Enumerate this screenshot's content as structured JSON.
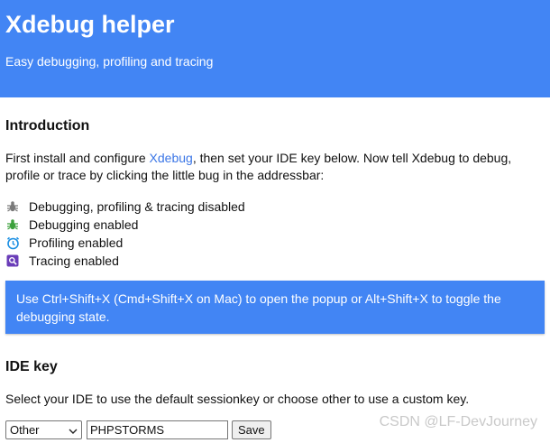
{
  "header": {
    "title": "Xdebug helper",
    "subtitle": "Easy debugging, profiling and tracing",
    "bg_color": "#4285f4"
  },
  "intro": {
    "title": "Introduction",
    "text_before_link": "First install and configure ",
    "link_text": "Xdebug",
    "text_after_link": ", then set your IDE key below. Now tell Xdebug to debug, profile or trace by clicking the little bug in the addressbar:"
  },
  "legend": [
    {
      "icon": "bug-icon-disabled",
      "color": "#7a7a7a",
      "label": "Debugging, profiling & tracing disabled"
    },
    {
      "icon": "bug-icon-enabled",
      "color": "#3ca13c",
      "label": "Debugging enabled"
    },
    {
      "icon": "clock-icon",
      "color": "#1a8fe3",
      "label": "Profiling enabled"
    },
    {
      "icon": "trace-magnifier-icon",
      "color": "#6a3db8",
      "label": "Tracing enabled"
    }
  ],
  "tip": {
    "text": "Use Ctrl+Shift+X (Cmd+Shift+X on Mac) to open the popup or Alt+Shift+X to toggle the debugging state."
  },
  "ide": {
    "title": "IDE key",
    "text": "Select your IDE to use the default sessionkey or choose other to use a custom key.",
    "select_value": "Other",
    "key_value": "PHPSTORMS",
    "save_label": "Save"
  },
  "watermark": "CSDN @LF-DevJourney"
}
